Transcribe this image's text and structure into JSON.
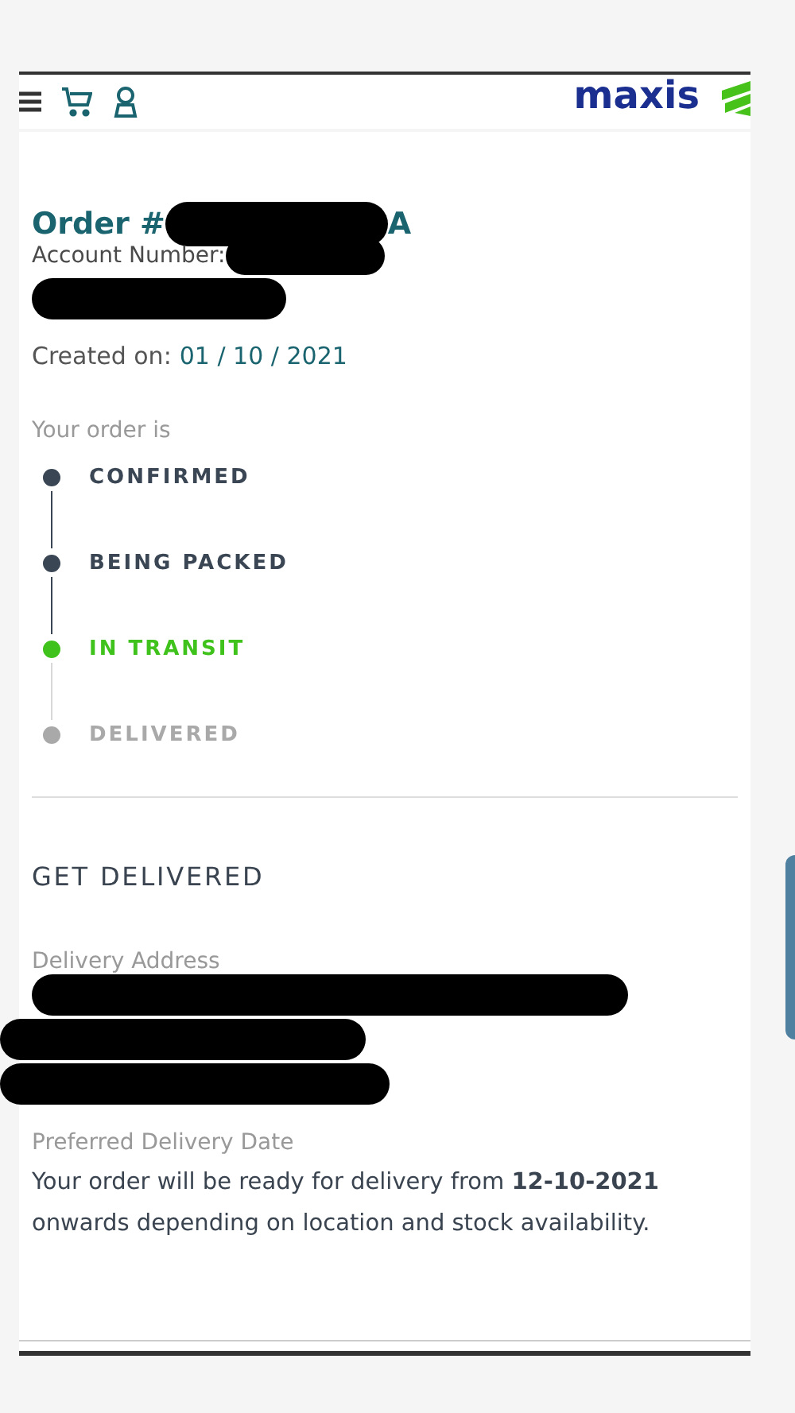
{
  "header": {
    "logo": "maxis"
  },
  "order": {
    "title_prefix": "Order #",
    "title_suffix": "A",
    "account_label": "Account Number:",
    "created_label": "Created on:",
    "created_date": "01 / 10 / 2021"
  },
  "tracking": {
    "intro": "Your order is",
    "steps": [
      {
        "label": "CONFIRMED",
        "kind": "done"
      },
      {
        "label": "BEING PACKED",
        "kind": "done"
      },
      {
        "label": "IN TRANSIT",
        "kind": "current"
      },
      {
        "label": "DELIVERED",
        "kind": "pending"
      }
    ]
  },
  "delivery": {
    "heading": "GET DELIVERED",
    "address_label": "Delivery Address",
    "date_label": "Preferred Delivery Date",
    "date_text": "Your order will be ready for delivery from **12-10-2021** onwards depending on location and stock availability."
  }
}
